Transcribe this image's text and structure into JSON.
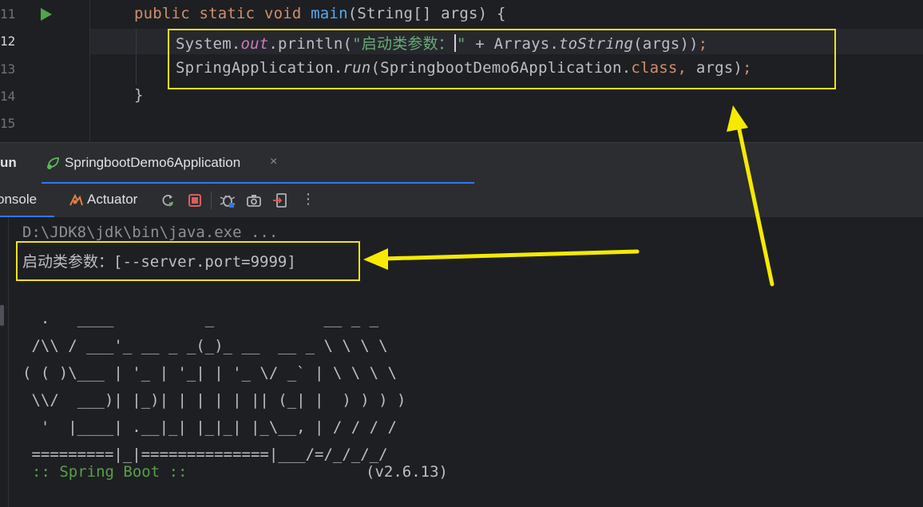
{
  "editor": {
    "line_numbers": [
      "11",
      "12",
      "13",
      "14",
      "15"
    ],
    "current_line": "12",
    "line1": {
      "kw": "public static void",
      "method": "main",
      "params": "(String[] args) {"
    },
    "line2": {
      "obj": "System.",
      "field": "out",
      "call": ".println(",
      "str_open": "\"启动类参数：",
      "str_close": "\"",
      "rest": " + Arrays.",
      "method": "toString",
      "args": "(args))",
      "semi": ";"
    },
    "line3": {
      "obj": "SpringApplication.",
      "method": "run",
      "open": "(SpringbootDemo6Application.",
      "cls": "class",
      "comma": ",",
      "args": " args)",
      "semi": ";"
    },
    "line4": "}"
  },
  "run_window": {
    "title": "un",
    "tab_label": "SpringbootDemo6Application",
    "tab_close": "×",
    "subtabs": {
      "console": "onsole",
      "actuator": "Actuator"
    },
    "more": "⋮"
  },
  "console": {
    "cmd_line": "D:\\JDK8\\jdk\\bin\\java.exe ...",
    "output_line": "启动类参数：[--server.port=9999]",
    "banner": "  .   ____          _            __ _ _\n /\\\\ / ___'_ __ _ _(_)_ __  __ _ \\ \\ \\ \\\n( ( )\\___ | '_ | '_| | '_ \\/ _` | \\ \\ \\ \\\n \\\\/  ___)| |_)| | | | | || (_| |  ) ) ) )\n  '  |____| .__|_| |_|_| |_\\__, | / / / /\n =========|_|==============|___/=/_/_/_/",
    "spring_label": ":: Spring Boot ::",
    "spring_version": "(v2.6.13)"
  },
  "colors": {
    "highlight": "#f2e21c",
    "accent": "#3574f0",
    "run_green": "#4fa64b"
  }
}
